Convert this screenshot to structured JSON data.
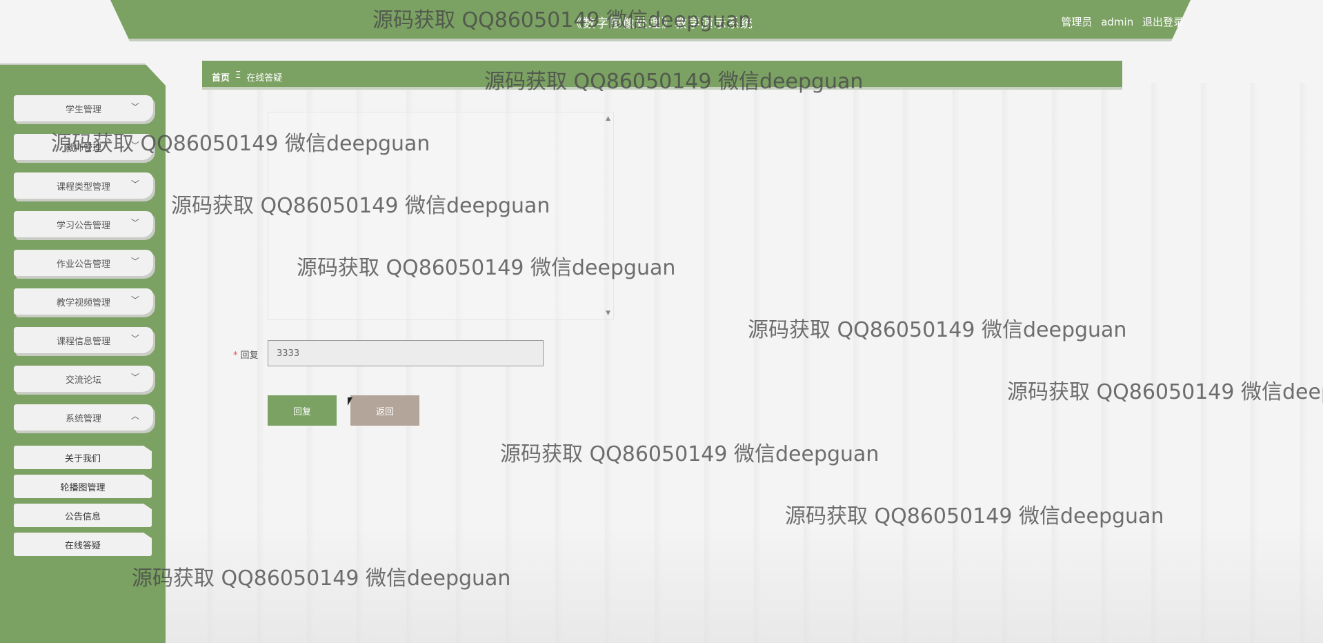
{
  "header": {
    "title": "《数字图像处理》教学演示系统",
    "role_label": "管理员",
    "username": "admin",
    "logout_label": "退出登录"
  },
  "breadcrumb": {
    "home": "首页",
    "separator": "Ξ",
    "current": "在线答疑"
  },
  "sidebar": {
    "items": [
      {
        "label": "学生管理",
        "expanded": false
      },
      {
        "label": "教师管理",
        "expanded": false
      },
      {
        "label": "课程类型管理",
        "expanded": false
      },
      {
        "label": "学习公告管理",
        "expanded": false
      },
      {
        "label": "作业公告管理",
        "expanded": false
      },
      {
        "label": "教学视频管理",
        "expanded": false
      },
      {
        "label": "课程信息管理",
        "expanded": false
      },
      {
        "label": "交流论坛",
        "expanded": false
      },
      {
        "label": "系统管理",
        "expanded": true
      }
    ],
    "sub_items": [
      {
        "label": "关于我们"
      },
      {
        "label": "轮播图管理"
      },
      {
        "label": "公告信息"
      },
      {
        "label": "在线答疑"
      }
    ]
  },
  "form": {
    "reply_label": "回复",
    "required_mark": "*",
    "reply_value": "3333",
    "submit_label": "回复",
    "back_label": "返回"
  },
  "icons": {
    "chevron_down": "chevron-down-icon",
    "chevron_up": "chevron-up-icon"
  },
  "colors": {
    "primary": "#7ba163",
    "back_button": "#b3a59a",
    "required": "#d9534f"
  },
  "watermark": {
    "text": "源码获取 QQ86050149 微信deepguan"
  }
}
